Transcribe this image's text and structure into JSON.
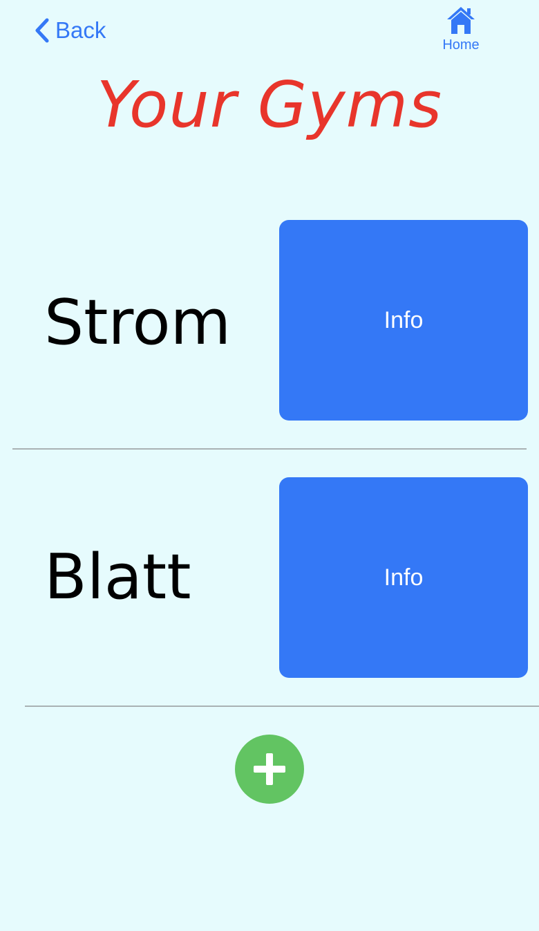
{
  "header": {
    "back_label": "Back",
    "back_icon": "chevron-left-icon",
    "home_label": "Home",
    "home_icon": "home-icon"
  },
  "title": "Your Gyms",
  "gyms": [
    {
      "name": "Strom",
      "info_label": "Info"
    },
    {
      "name": "Blatt",
      "info_label": "Info"
    }
  ],
  "add_button": {
    "icon": "plus-icon"
  },
  "colors": {
    "background": "#e6fbfd",
    "accent_blue": "#3478f6",
    "title_red": "#e8352b",
    "add_green": "#62c462",
    "separator": "#a9b1b3"
  }
}
